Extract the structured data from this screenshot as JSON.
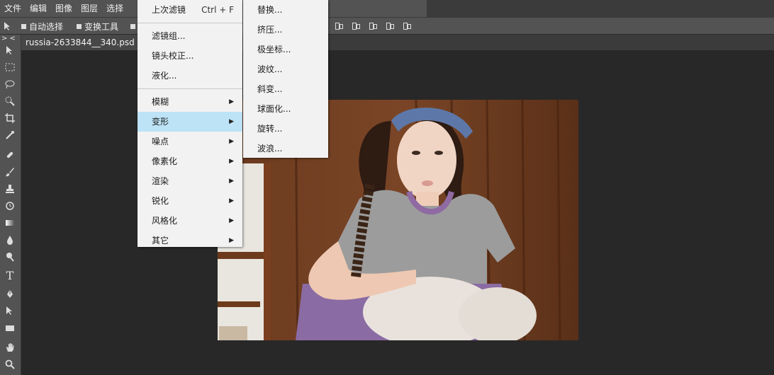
{
  "menubar": {
    "items": [
      "文件",
      "编辑",
      "图像",
      "图层",
      "选择"
    ]
  },
  "options": {
    "auto_select": "自动选择",
    "transform": "变换工具"
  },
  "document": {
    "tab_title": "russia-2633844__340.psd *"
  },
  "filter_menu": {
    "last_filter": "上次滤镜",
    "last_filter_shortcut": "Ctrl + F",
    "filter_gallery": "滤镜组...",
    "lens_correction": "镜头校正...",
    "liquify": "液化...",
    "submenus": [
      "模糊",
      "变形",
      "噪点",
      "像素化",
      "渲染",
      "锐化",
      "风格化",
      "其它"
    ],
    "highlighted": "变形"
  },
  "distort_menu": {
    "items": [
      "替换...",
      "挤压...",
      "极坐标...",
      "波纹...",
      "斜变...",
      "球面化...",
      "旋转...",
      "波浪..."
    ]
  },
  "toolbar": {
    "type_tool_glyph": "T",
    "collapse_glyph": "> <"
  },
  "colors": {
    "highlight": "#bde3f6",
    "panel": "#535353",
    "workspace": "#282828"
  }
}
